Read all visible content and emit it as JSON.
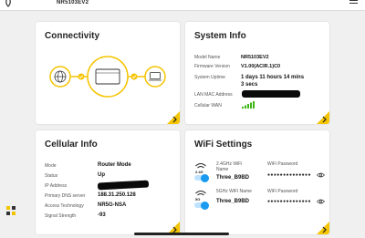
{
  "topbar": {
    "title": "NR5103EV2"
  },
  "connectivity": {
    "title": "Connectivity"
  },
  "system_info": {
    "title": "System Info",
    "rows": [
      {
        "label": "Model Name",
        "value": "NR5103EV2"
      },
      {
        "label": "Firmware Version",
        "value": "V1.00(ACIR.1)C0"
      },
      {
        "label": "System Uptime",
        "value": "1 days 11 hours 14 mins 3 secs"
      },
      {
        "label": "LAN MAC Address",
        "value": ""
      },
      {
        "label": "Cellular WAN",
        "value": ""
      }
    ]
  },
  "cellular_info": {
    "title": "Cellular Info",
    "rows": [
      {
        "label": "Mode",
        "value": "Router Mode"
      },
      {
        "label": "Status",
        "value": "Up"
      },
      {
        "label": "IP Address",
        "value": ""
      },
      {
        "label": "Primary DNS server",
        "value": "188.31.250.128"
      },
      {
        "label": "Access Technology",
        "value": "NR5G-NSA"
      },
      {
        "label": "Signal Strength",
        "value": "-93"
      }
    ]
  },
  "wifi_settings": {
    "title": "WiFi Settings",
    "networks": [
      {
        "band": "2.4G",
        "name_label": "2.4GHz WiFi Name",
        "ssid": "Three_B9BD",
        "password_label": "WiFi Password",
        "password": "●●●●●●●●●●●●●●",
        "enabled": true
      },
      {
        "band": "5G",
        "name_label": "5GHz WiFi Name",
        "ssid": "Three_B9BD",
        "password_label": "WiFi Password",
        "password": "●●●●●●●●●●●●●●",
        "enabled": true
      }
    ]
  },
  "colors": {
    "accent": "#f5c400",
    "toggle": "#1a9bf0",
    "signal": "#3fb618"
  }
}
